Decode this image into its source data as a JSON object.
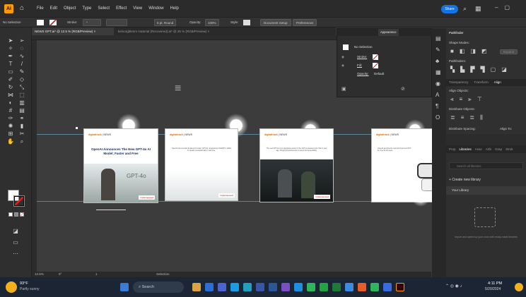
{
  "app": {
    "logo": "Ai",
    "home_icon": "home-icon"
  },
  "menu": [
    "File",
    "Edit",
    "Object",
    "Type",
    "Select",
    "Effect",
    "View",
    "Window",
    "Help"
  ],
  "topbar": {
    "share": "Share"
  },
  "control_bar": {
    "selection": "No Selection",
    "stroke_label": "Stroke:",
    "brush": "5 pt. Round",
    "opacity_label": "Opacity:",
    "opacity": "100%",
    "style_label": "Style:",
    "doc_setup": "Document Setup",
    "preferences": "Preferences"
  },
  "tabs": [
    {
      "label": "NEWS GPT.ai* @ 12.5 % (RGB/Preview)",
      "close": "×"
    },
    {
      "label": "keloorgbkmm material (Recovered).ai* @ 25 % (RGB/Preview)",
      "close": "×"
    }
  ],
  "artboards": [
    {
      "site": "digitaltrack",
      "section": "NEWS",
      "title": "OpenAI Announces The New GPT-4o AI Model; Faster and Free",
      "overlay": "GPT-4o",
      "brand": "Cybersecured"
    },
    {
      "site": "digitaltrack",
      "section": "NEWS",
      "body": "OpenAI has unveiled its latest AI model, GPT-4o, showcasing ChatGPT's ability to speak conversationally in real time.",
      "brand": "Cybersecured"
    },
    {
      "site": "digitaltrack",
      "section": "NEWS",
      "body": "The new GPT-4o is an upgraded version of the GPT-4 released more than a year ago, bringing improvements to speed and accessibility.",
      "brand": "Cybersecured"
    },
    {
      "site": "digitaltrack",
      "section": "NEWS",
      "body": "OpenAI launched its new and improved GPT-4o, free for all users.",
      "brand": ""
    }
  ],
  "status_bar": {
    "zoom": "12.5%",
    "rotate": "0°",
    "artboard": "1",
    "mode": "Selection"
  },
  "properties_panel": {
    "tabs": [
      "Appearance"
    ],
    "selection": "No Selection",
    "stroke": "Stroke:",
    "fill": "Fill:",
    "opacity": "Opacity:",
    "opacity_value": "Default"
  },
  "pathfinder": {
    "tab": "Pathfinder",
    "shape_modes": "Shape Modes:",
    "expand": "Expand",
    "pathfinders": "Pathfinders:",
    "subtabs": [
      "Transparency",
      "Transform",
      "Align"
    ],
    "align_objects": "Align Objects:",
    "distribute_objects": "Distribute Objects:",
    "distribute_spacing": "Distribute Spacing:",
    "align_to": "Align To:"
  },
  "libraries": {
    "tabs": [
      "Prop",
      "Libraries",
      "Asse",
      "Artb",
      "Grap",
      "Strok"
    ],
    "search": "Search all libraries",
    "create": "Create new library",
    "your_library": "Your Library",
    "hint": "Import and speed up your work with ready-made libraries"
  },
  "taskbar": {
    "weather_temp": "93°F",
    "weather_desc": "Partly sunny",
    "search": "Search",
    "time": "4:11 PM",
    "date": "5/20/2024"
  }
}
